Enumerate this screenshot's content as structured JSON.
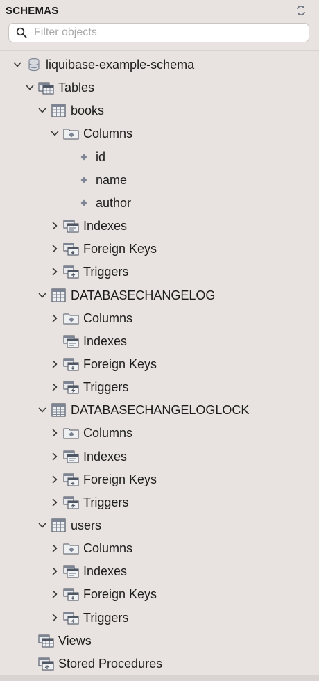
{
  "header": {
    "title": "SCHEMAS",
    "refresh_icon": "refresh-icon"
  },
  "search": {
    "placeholder": "Filter objects",
    "value": "",
    "icon": "search-icon"
  },
  "tree": {
    "schema": {
      "label": "liquibase-example-schema",
      "expanded": true
    },
    "tables_folder": {
      "label": "Tables",
      "expanded": true
    },
    "tables": [
      {
        "name": "books",
        "expanded": true,
        "columns": {
          "label": "Columns",
          "expanded": true,
          "items": [
            "id",
            "name",
            "author"
          ]
        },
        "indexes": {
          "label": "Indexes",
          "expandable": true
        },
        "foreign_keys": {
          "label": "Foreign Keys",
          "expandable": true
        },
        "triggers": {
          "label": "Triggers",
          "expandable": true
        }
      },
      {
        "name": "DATABASECHANGELOG",
        "expanded": true,
        "columns": {
          "label": "Columns",
          "expanded": false
        },
        "indexes": {
          "label": "Indexes",
          "expandable": false
        },
        "foreign_keys": {
          "label": "Foreign Keys",
          "expandable": true
        },
        "triggers": {
          "label": "Triggers",
          "expandable": true
        }
      },
      {
        "name": "DATABASECHANGELOGLOCK",
        "expanded": true,
        "columns": {
          "label": "Columns",
          "expanded": false
        },
        "indexes": {
          "label": "Indexes",
          "expandable": true
        },
        "foreign_keys": {
          "label": "Foreign Keys",
          "expandable": true
        },
        "triggers": {
          "label": "Triggers",
          "expandable": true
        }
      },
      {
        "name": "users",
        "expanded": true,
        "columns": {
          "label": "Columns",
          "expanded": false
        },
        "indexes": {
          "label": "Indexes",
          "expandable": true
        },
        "foreign_keys": {
          "label": "Foreign Keys",
          "expandable": true
        },
        "triggers": {
          "label": "Triggers",
          "expandable": true
        }
      }
    ],
    "views_folder": {
      "label": "Views"
    },
    "procedures_folder": {
      "label": "Stored Procedures"
    }
  },
  "colors": {
    "background": "#e8e3e0",
    "icon_gray": "#7d8594",
    "icon_dark": "#4f5663"
  }
}
